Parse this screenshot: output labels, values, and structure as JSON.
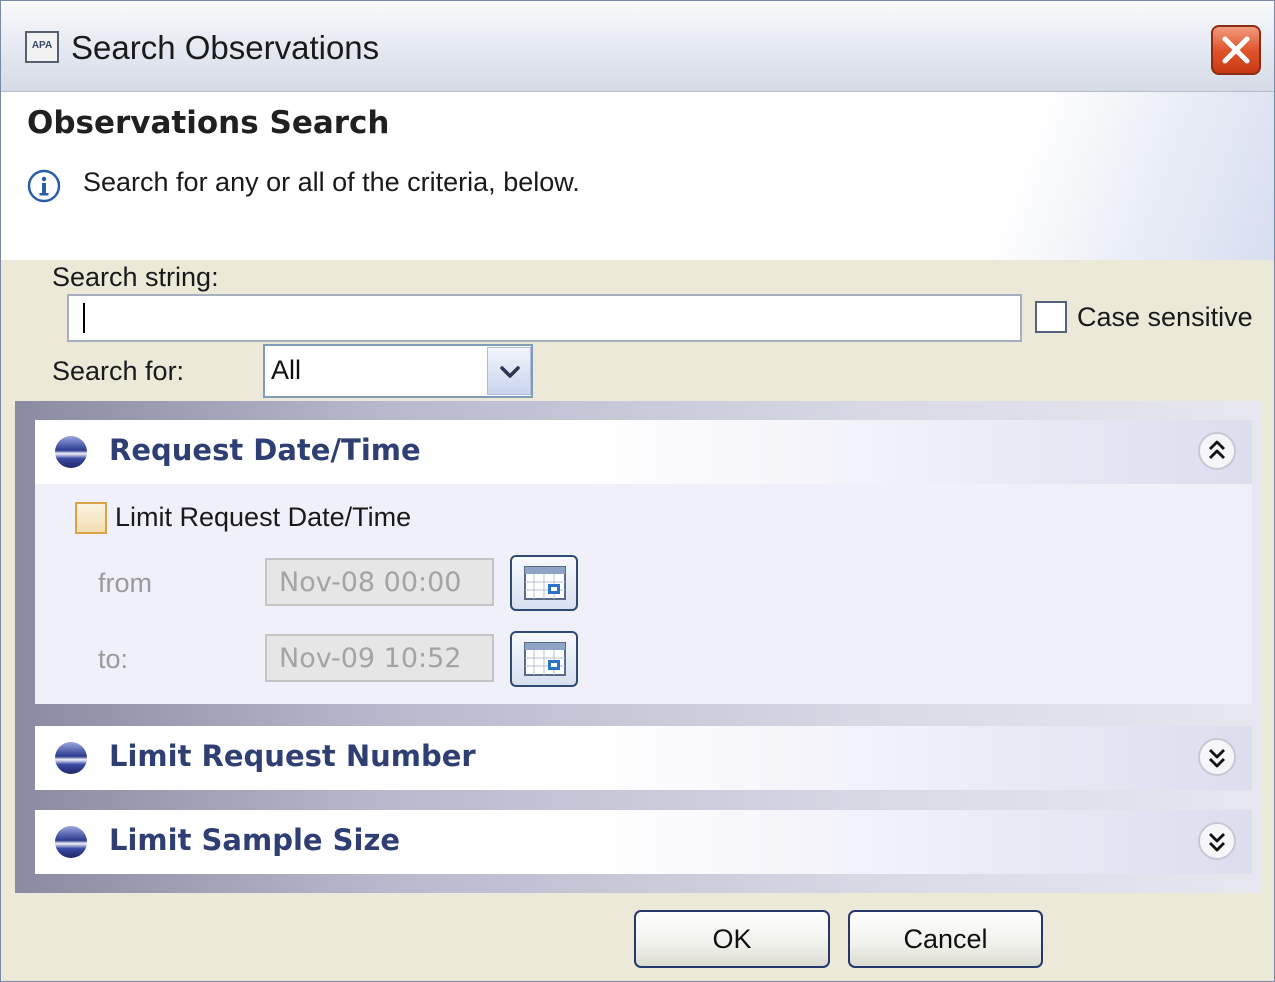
{
  "window": {
    "title": "Search Observations",
    "app_icon_text": "APA"
  },
  "header": {
    "title": "Observations Search",
    "message": "Search for any or all of the criteria, below."
  },
  "form": {
    "search_string_label": "Search string:",
    "search_string_value": "",
    "case_sensitive_label": "Case sensitive",
    "case_sensitive_checked": false,
    "search_for_label": "Search for:",
    "search_for_value": "All"
  },
  "sections": [
    {
      "title": "Request Date/Time",
      "expanded": true,
      "limit_label": "Limit Request Date/Time",
      "limit_checked": false,
      "from_label": "from",
      "from_value": "Nov-08 00:00",
      "to_label": "to:",
      "to_value": "Nov-09 10:52"
    },
    {
      "title": "Limit Request Number",
      "expanded": false
    },
    {
      "title": "Limit Sample Size",
      "expanded": false
    }
  ],
  "buttons": {
    "ok": "OK",
    "cancel": "Cancel"
  },
  "colors": {
    "section_title": "#2f3e73",
    "close_button": "#e0552e",
    "accent_border": "#26386b"
  }
}
